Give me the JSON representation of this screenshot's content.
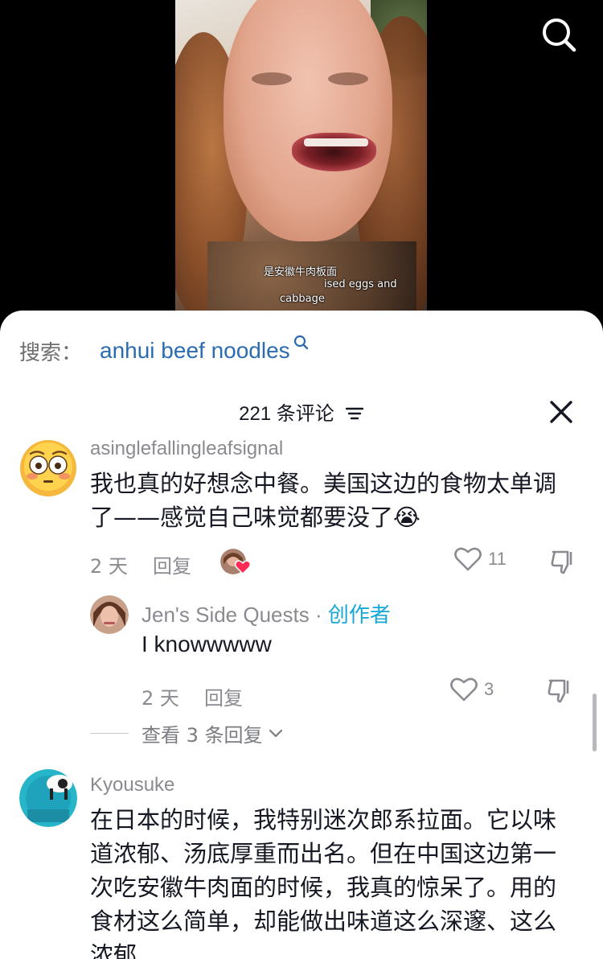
{
  "video": {
    "subtitle_lines": [
      "是安徽牛肉板面",
      "ised eggs and",
      "cabbage"
    ]
  },
  "search": {
    "label": "搜索：",
    "term": "anhui beef noodles"
  },
  "comments_header": {
    "count_text": "221 条评论"
  },
  "comments": [
    {
      "username": "asinglefallingleafsignal",
      "text_line1": "我也真的好想念中餐。美国这边的食物太单调",
      "text_line2": "了——感觉自己味觉都要没了😭",
      "time": "2 天",
      "reply_label": "回复",
      "likes": "11"
    },
    {
      "username": "Jen's Side Quests",
      "separator": " · ",
      "creator_label": "创作者",
      "text": "I knowwwww",
      "time": "2 天",
      "reply_label": "回复",
      "likes": "3"
    },
    {
      "view_replies": "查看 3 条回复"
    },
    {
      "username": "Kyousuke",
      "lines": [
        "在日本的时候，我特别迷次郎系拉面。它以味",
        "道浓郁、汤底厚重而出名。但在中国这边第一",
        "次吃安徽牛肉面的时候，我真的惊呆了。用的",
        "食材这么简单，却能做出味道这么深邃、这么",
        "浓郁"
      ]
    }
  ],
  "colors": {
    "link_blue": "#2b6cb0",
    "creator_blue": "#16a8d6",
    "like_red": "#fe2c55"
  }
}
